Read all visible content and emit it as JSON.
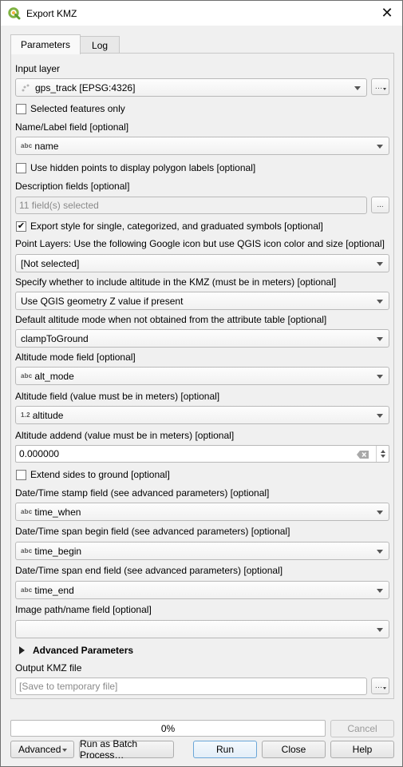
{
  "window": {
    "title": "Export KMZ",
    "close_icon": "close-icon",
    "app_icon": "qgis-logo-icon"
  },
  "tabs": [
    {
      "label": "Parameters",
      "active": true
    },
    {
      "label": "Log",
      "active": false
    }
  ],
  "params": {
    "input_layer": {
      "label": "Input layer",
      "value": "gps_track [EPSG:4326]",
      "icon": "point-layer-icon",
      "browse_label": "…"
    },
    "selected_only": {
      "label": "Selected features only",
      "checked": false
    },
    "name_field": {
      "label": "Name/Label field [optional]",
      "type": "abc",
      "value": "name"
    },
    "hidden_points": {
      "label": "Use hidden points to display polygon labels [optional]",
      "checked": false
    },
    "description_fields": {
      "label": "Description fields [optional]",
      "value": "11 field(s) selected",
      "browse_label": "..."
    },
    "export_style": {
      "label": "Export style for single, categorized, and graduated symbols [optional]",
      "checked": true,
      "check_glyph": "✔"
    },
    "point_icon": {
      "label": "Point Layers: Use the following Google icon but use QGIS icon color and size [optional]",
      "value": "[Not selected]"
    },
    "include_altitude": {
      "label": "Specify whether to include altitude in the KMZ (must be in meters) [optional]",
      "value": "Use QGIS geometry Z value if present"
    },
    "default_alt_mode": {
      "label": "Default altitude mode when not obtained from the attribute table [optional]",
      "value": "clampToGround"
    },
    "alt_mode_field": {
      "label": "Altitude mode field [optional]",
      "type": "abc",
      "value": "alt_mode"
    },
    "altitude_field": {
      "label": "Altitude field (value must be in meters) [optional]",
      "type": "1.2",
      "value": "altitude"
    },
    "altitude_addend": {
      "label": "Altitude addend (value must be in meters) [optional]",
      "value": "0.000000"
    },
    "extend_sides": {
      "label": "Extend sides to ground [optional]",
      "checked": false
    },
    "time_stamp_field": {
      "label": "Date/Time stamp field (see advanced parameters) [optional]",
      "type": "abc",
      "value": "time_when"
    },
    "time_begin_field": {
      "label": "Date/Time span begin field (see advanced parameters) [optional]",
      "type": "abc",
      "value": "time_begin"
    },
    "time_end_field": {
      "label": "Date/Time span end field (see advanced parameters) [optional]",
      "type": "abc",
      "value": "time_end"
    },
    "image_field": {
      "label": "Image path/name field [optional]",
      "value": ""
    },
    "advanced_parameters": {
      "label": "Advanced Parameters",
      "expanded": false
    },
    "output_file": {
      "label": "Output KMZ file",
      "placeholder": "[Save to temporary file]",
      "browse_label": "…"
    }
  },
  "footer": {
    "progress_percent": 0,
    "progress_text": "0%",
    "cancel_label": "Cancel",
    "advanced_label": "Advanced",
    "batch_label": "Run as Batch Process…",
    "run_label": "Run",
    "close_label": "Close",
    "help_label": "Help"
  }
}
